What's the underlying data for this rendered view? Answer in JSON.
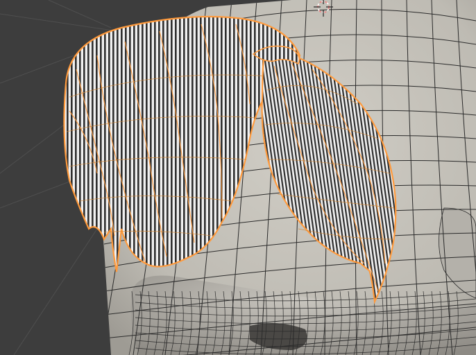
{
  "viewport": {
    "background_color": "#3d3d3d",
    "grid_color": "#525252",
    "mesh_surface_color": "#c8c5bd",
    "mesh_shade_color": "#8e8b84",
    "wire_color": "#2a2a2a",
    "selection_color": "#ff9a3c",
    "hair_stripe_dark": "#2c2c2c",
    "hair_stripe_light": "#f2f2f2",
    "cursor_color": "#f08080"
  },
  "icons": {
    "cursor": "3d-cursor-icon"
  }
}
